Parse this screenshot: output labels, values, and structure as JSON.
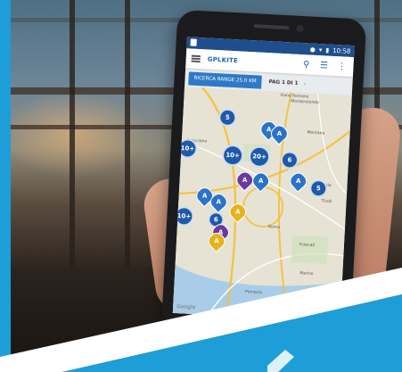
{
  "phone": {
    "status_time": "10:58",
    "logo_text": "GPLKITE",
    "range_button": "RICERCA RANGE 25.0 KM",
    "page_indicator": "PAG 1 DI 1",
    "map_credit": "Google",
    "clusters": [
      {
        "label": "5"
      },
      {
        "label": "10+"
      },
      {
        "label": "20+"
      },
      {
        "label": "6"
      },
      {
        "label": "10+"
      },
      {
        "label": "5"
      },
      {
        "label": "10+"
      },
      {
        "label": "6"
      }
    ],
    "pins": [
      {
        "label": "A"
      },
      {
        "label": "A"
      },
      {
        "label": "A"
      },
      {
        "label": "A"
      },
      {
        "label": "A"
      },
      {
        "label": "A"
      },
      {
        "label": "A"
      },
      {
        "label": "A"
      },
      {
        "label": "A"
      },
      {
        "label": "A"
      }
    ],
    "towns": [
      "Monterotondo",
      "Fiano Romano",
      "Mentana",
      "Bracciano",
      "Guidonia",
      "Tivoli",
      "Roma",
      "Frascati",
      "Pomezia",
      "Marino"
    ]
  },
  "colors": {
    "brand_blue": "#1d9ed8",
    "pin_blue": "#2a73c9",
    "cluster_blue": "#1e5aa8",
    "pin_yellow": "#e7b21e",
    "pin_purple": "#6a3a9c"
  }
}
